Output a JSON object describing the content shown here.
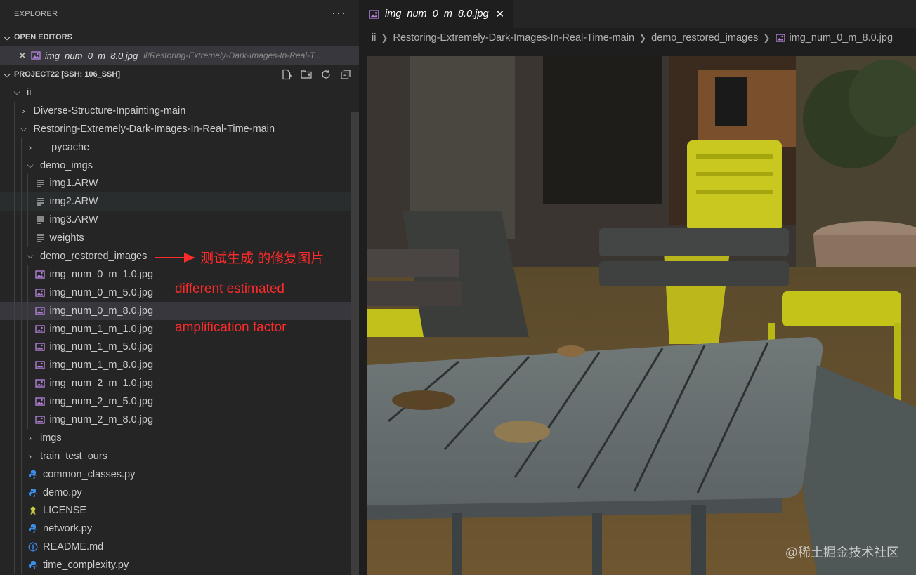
{
  "explorer": {
    "title": "EXPLORER",
    "more_icon": "ellipsis-icon",
    "open_editors": {
      "label": "OPEN EDITORS",
      "items": [
        {
          "name": "img_num_0_m_8.0.jpg",
          "path": "ii/Restoring-Extremely-Dark-Images-In-Real-T..."
        }
      ]
    },
    "project": {
      "label": "PROJECT22 [SSH: 106_SSH]",
      "actions": [
        "new-file-icon",
        "new-folder-icon",
        "refresh-icon",
        "collapse-all-icon"
      ]
    },
    "tree": [
      {
        "label": "ii",
        "depth": 0,
        "kind": "folder-open"
      },
      {
        "label": "Diverse-Structure-Inpainting-main",
        "depth": 1,
        "kind": "folder-closed"
      },
      {
        "label": "Restoring-Extremely-Dark-Images-In-Real-Time-main",
        "depth": 1,
        "kind": "folder-open"
      },
      {
        "label": "__pycache__",
        "depth": 2,
        "kind": "folder-closed"
      },
      {
        "label": "demo_imgs",
        "depth": 2,
        "kind": "folder-open"
      },
      {
        "label": "img1.ARW",
        "depth": 3,
        "kind": "text-file"
      },
      {
        "label": "img2.ARW",
        "depth": 3,
        "kind": "text-file",
        "state": "hover"
      },
      {
        "label": "img3.ARW",
        "depth": 3,
        "kind": "text-file"
      },
      {
        "label": "weights",
        "depth": 3,
        "kind": "text-file"
      },
      {
        "label": "demo_restored_images",
        "depth": 2,
        "kind": "folder-open"
      },
      {
        "label": "img_num_0_m_1.0.jpg",
        "depth": 3,
        "kind": "image-file"
      },
      {
        "label": "img_num_0_m_5.0.jpg",
        "depth": 3,
        "kind": "image-file"
      },
      {
        "label": "img_num_0_m_8.0.jpg",
        "depth": 3,
        "kind": "image-file",
        "state": "selected"
      },
      {
        "label": "img_num_1_m_1.0.jpg",
        "depth": 3,
        "kind": "image-file"
      },
      {
        "label": "img_num_1_m_5.0.jpg",
        "depth": 3,
        "kind": "image-file"
      },
      {
        "label": "img_num_1_m_8.0.jpg",
        "depth": 3,
        "kind": "image-file"
      },
      {
        "label": "img_num_2_m_1.0.jpg",
        "depth": 3,
        "kind": "image-file"
      },
      {
        "label": "img_num_2_m_5.0.jpg",
        "depth": 3,
        "kind": "image-file"
      },
      {
        "label": "img_num_2_m_8.0.jpg",
        "depth": 3,
        "kind": "image-file"
      },
      {
        "label": "imgs",
        "depth": 2,
        "kind": "folder-closed"
      },
      {
        "label": "train_test_ours",
        "depth": 2,
        "kind": "folder-closed"
      },
      {
        "label": "common_classes.py",
        "depth": 2,
        "kind": "python-file"
      },
      {
        "label": "demo.py",
        "depth": 2,
        "kind": "python-file"
      },
      {
        "label": "LICENSE",
        "depth": 2,
        "kind": "license-file"
      },
      {
        "label": "network.py",
        "depth": 2,
        "kind": "python-file"
      },
      {
        "label": "README.md",
        "depth": 2,
        "kind": "info-file"
      },
      {
        "label": "time_complexity.py",
        "depth": 2,
        "kind": "python-file"
      }
    ]
  },
  "annotations": {
    "arrow_note": "测试生成 的修复图片",
    "line1": "different estimated",
    "line2": "amplification factor",
    "color": "#ff2a2a"
  },
  "editor": {
    "tab": {
      "label": "img_num_0_m_8.0.jpg",
      "icon": "image-file-icon"
    },
    "breadcrumb": [
      "ii",
      "Restoring-Extremely-Dark-Images-In-Real-Time-main",
      "demo_restored_images",
      "img_num_0_m_8.0.jpg"
    ],
    "watermark": "@稀土掘金技术社区"
  },
  "colors": {
    "sidebar_bg": "#252526",
    "editor_bg": "#1e1e1e",
    "selected_row": "#37373d",
    "image_icon": "#b180d7",
    "python_icon": "#3b8eea",
    "license_icon": "#cbcb41"
  }
}
